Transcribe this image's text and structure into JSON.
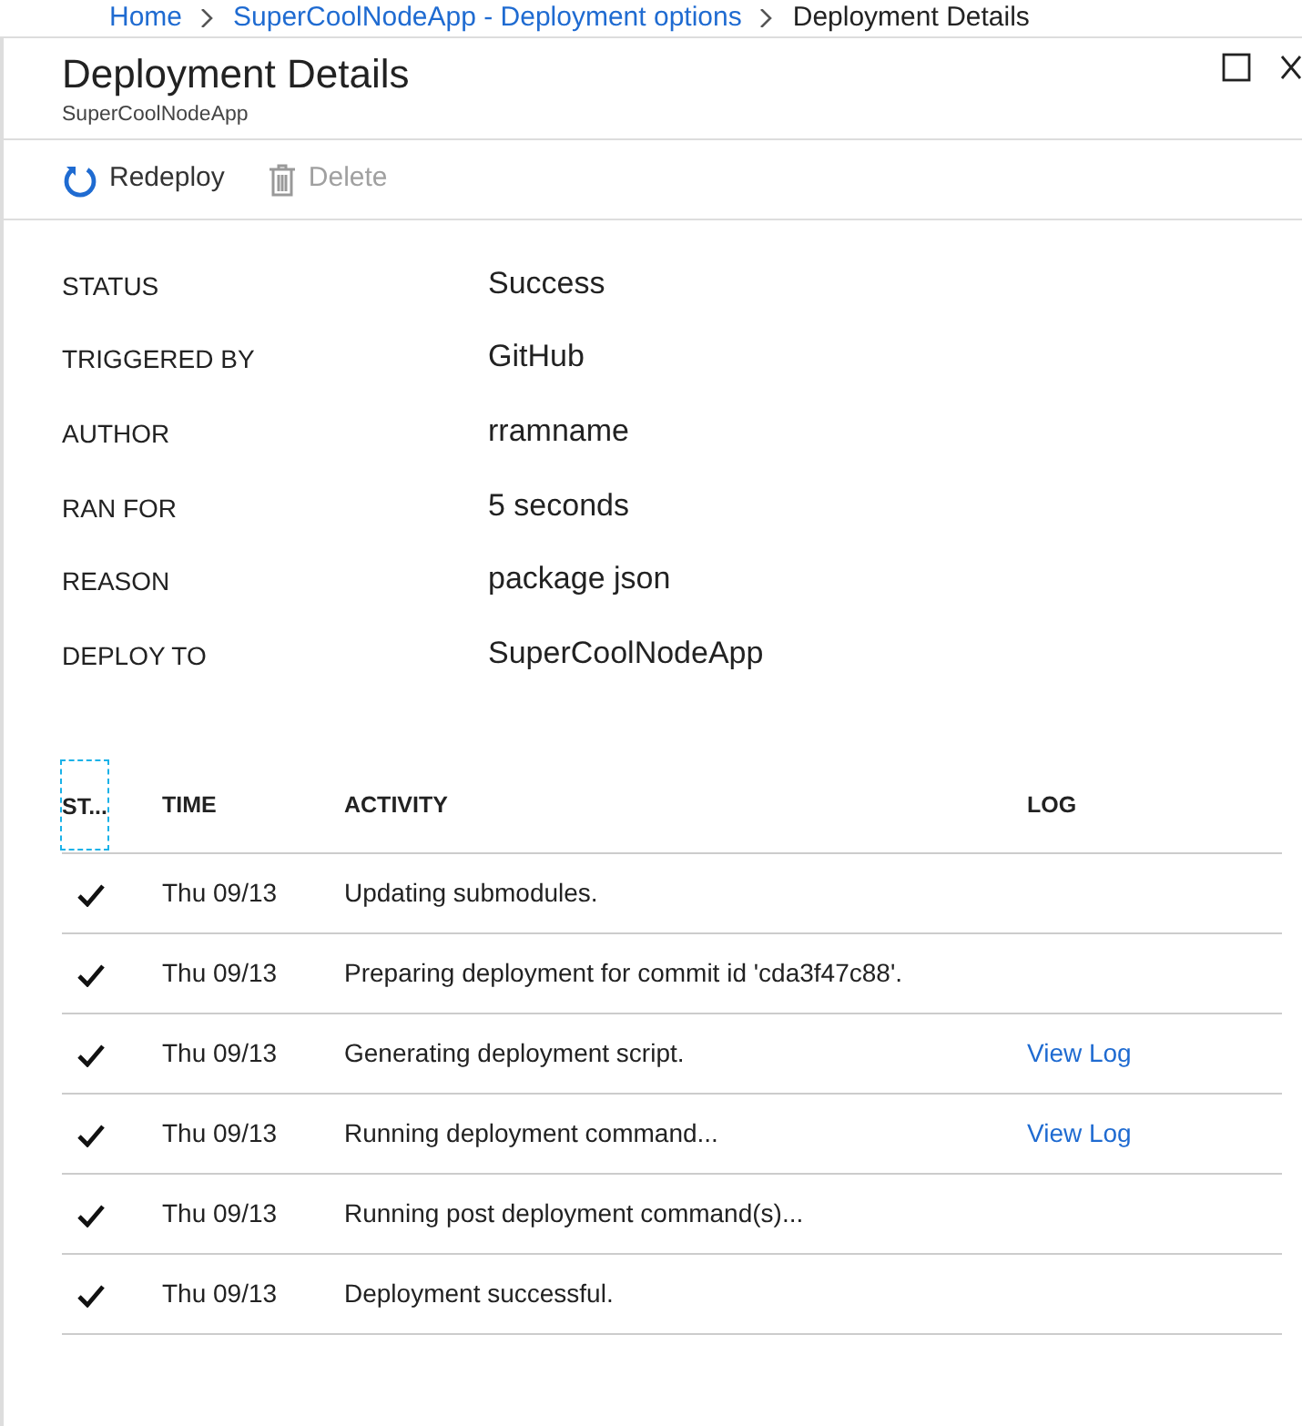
{
  "breadcrumb": [
    {
      "label": "Home",
      "current": false
    },
    {
      "label": "SuperCoolNodeApp - Deployment options",
      "current": false
    },
    {
      "label": "Deployment Details",
      "current": true
    }
  ],
  "blade": {
    "title": "Deployment Details",
    "subtitle": "SuperCoolNodeApp"
  },
  "toolbar": [
    {
      "label": "Redeploy",
      "kind": "redeploy",
      "disabled": false
    },
    {
      "label": "Delete",
      "kind": "delete",
      "disabled": true
    }
  ],
  "details": [
    {
      "label": "STATUS",
      "value": "Success"
    },
    {
      "label": "TRIGGERED BY",
      "value": "GitHub"
    },
    {
      "label": "AUTHOR",
      "value": "rramname"
    },
    {
      "label": "RAN FOR",
      "value": "5 seconds"
    },
    {
      "label": "REASON",
      "value": "package json"
    },
    {
      "label": "DEPLOY TO",
      "value": "SuperCoolNodeApp"
    }
  ],
  "table": {
    "columns": [
      {
        "label": "ST...",
        "focused": true
      },
      {
        "label": "TIME",
        "focused": false
      },
      {
        "label": "ACTIVITY",
        "focused": false
      },
      {
        "label": "LOG",
        "focused": false
      }
    ],
    "rows": [
      {
        "kind": "success",
        "time": "Thu 09/13",
        "activity": "Updating submodules."
      },
      {
        "kind": "success",
        "time": "Thu 09/13",
        "activity": "Preparing deployment for commit id 'cda3f47c88'."
      },
      {
        "kind": "success",
        "time": "Thu 09/13",
        "activity": "Generating deployment script.",
        "log": "View Log"
      },
      {
        "kind": "success",
        "time": "Thu 09/13",
        "activity": "Running deployment command...",
        "log": "View Log"
      },
      {
        "kind": "success",
        "time": "Thu 09/13",
        "activity": "Running post deployment command(s)..."
      },
      {
        "kind": "success",
        "time": "Thu 09/13",
        "activity": "Deployment successful."
      }
    ]
  }
}
